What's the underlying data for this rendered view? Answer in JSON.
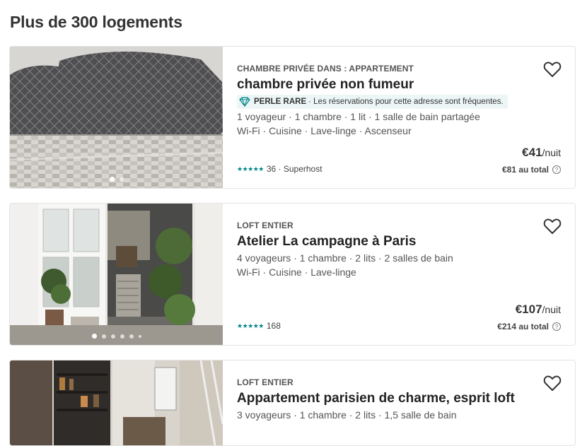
{
  "results": {
    "heading": "Plus de 300 logements"
  },
  "listings": [
    {
      "type": "CHAMBRE PRIVÉE DANS : APPARTEMENT",
      "title": "chambre privée non fumeur",
      "badge_strong": "PERLE RARE",
      "badge_text": "· Les réservations pour cette adresse sont fréquentes.",
      "details": "1 voyageur · 1 chambre · 1 lit · 1 salle de bain partagée",
      "amenities": "Wi-Fi · Cuisine · Lave-linge · Ascenseur",
      "stars": "★★★★★",
      "rating_text": "36 · Superhost",
      "price": "€41",
      "price_unit": "/nuit",
      "total": "€81 au total",
      "photo_count": 2
    },
    {
      "type": "LOFT ENTIER",
      "title": "Atelier La campagne à Paris",
      "details": "4 voyageurs · 1 chambre · 2 lits · 2 salles de bain",
      "amenities": "Wi-Fi · Cuisine · Lave-linge",
      "stars": "★★★★★",
      "rating_text": "168",
      "price": "€107",
      "price_unit": "/nuit",
      "total": "€214 au total",
      "photo_count": 6
    },
    {
      "type": "LOFT ENTIER",
      "title": "Appartement parisien de charme, esprit loft",
      "details": "3 voyageurs · 1 chambre · 2 lits · 1,5 salle de bain"
    }
  ],
  "icons": {
    "heart": "heart-icon",
    "gem": "diamond-icon",
    "help": "question-circle-icon"
  },
  "colors": {
    "accent": "#008489",
    "badge_bg": "#edf6f6",
    "text": "#222222"
  },
  "help_glyph": "?"
}
